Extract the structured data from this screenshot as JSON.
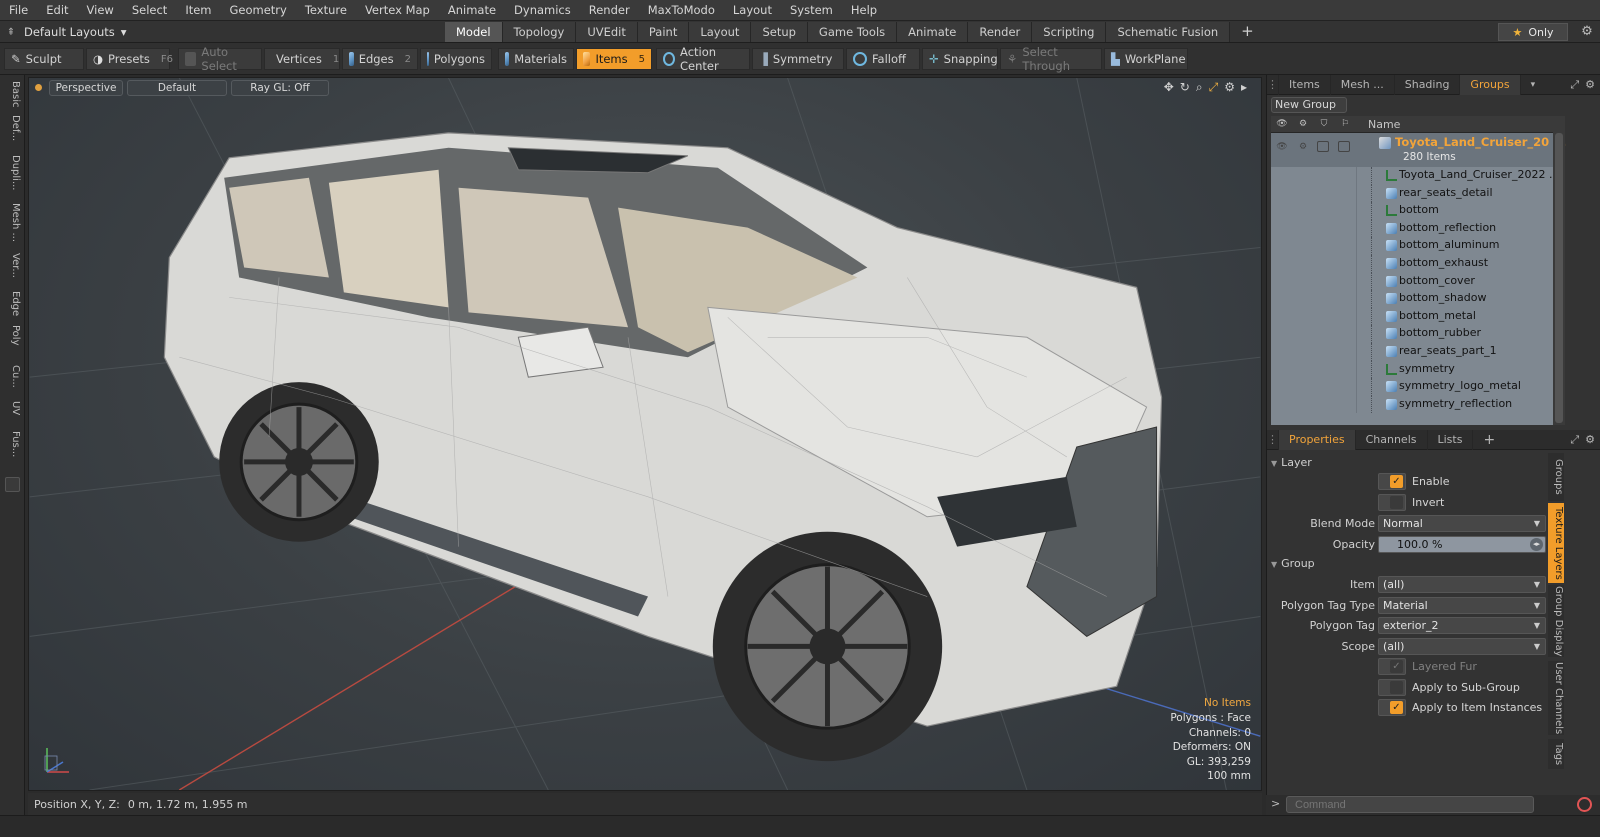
{
  "menu": [
    "File",
    "Edit",
    "View",
    "Select",
    "Item",
    "Geometry",
    "Texture",
    "Vertex Map",
    "Animate",
    "Dynamics",
    "Render",
    "MaxToModo",
    "Layout",
    "System",
    "Help"
  ],
  "layout": {
    "selector": "Default Layouts",
    "tabs": [
      "Model",
      "Topology",
      "UVEdit",
      "Paint",
      "Layout",
      "Setup",
      "Game Tools",
      "Animate",
      "Render",
      "Scripting",
      "Schematic Fusion"
    ],
    "active_tab": "Model",
    "only_label": "Only"
  },
  "toolbar": {
    "sculpt": "Sculpt",
    "presets": "Presets",
    "presets_key": "F6",
    "auto_select": "Auto Select",
    "vertices": "Vertices",
    "vertices_key": "1",
    "edges": "Edges",
    "edges_key": "2",
    "polygons": "Polygons",
    "materials": "Materials",
    "items": "Items",
    "items_key": "5",
    "action_center": "Action Center",
    "symmetry": "Symmetry",
    "falloff": "Falloff",
    "snapping": "Snapping",
    "select_through": "Select Through",
    "workplane": "WorkPlane"
  },
  "left_tabs": [
    "Basic",
    "Def...",
    "Dupli...",
    "Mesh ...",
    "Ver...",
    "Edge",
    "Poly",
    "Cu...",
    "UV",
    "Fus..."
  ],
  "viewport": {
    "view": "Perspective",
    "shading": "Default",
    "raygl": "Ray GL: Off",
    "stats": {
      "selection": "No Items",
      "polygons": "Polygons : Face",
      "channels": "Channels: 0",
      "deformers": "Deformers: ON",
      "gl": "GL: 393,259",
      "scale": "100 mm"
    }
  },
  "status": {
    "position_label": "Position X, Y, Z:",
    "position_value": "0 m, 1.72 m, 1.955 m"
  },
  "items_panel": {
    "tabs": [
      "Items",
      "Mesh ...",
      "Shading",
      "Groups"
    ],
    "active": "Groups",
    "new_group": "New Group",
    "name_col": "Name",
    "group_name": "Toyota_Land_Cruiser_20 ...",
    "group_count": "280 Items",
    "items": [
      {
        "name": "Toyota_Land_Cruiser_2022 ...",
        "type": "locator"
      },
      {
        "name": "rear_seats_detail",
        "type": "mesh"
      },
      {
        "name": "bottom",
        "type": "locator"
      },
      {
        "name": "bottom_reflection",
        "type": "mesh"
      },
      {
        "name": "bottom_aluminum",
        "type": "mesh"
      },
      {
        "name": "bottom_exhaust",
        "type": "mesh"
      },
      {
        "name": "bottom_cover",
        "type": "mesh"
      },
      {
        "name": "bottom_shadow",
        "type": "mesh"
      },
      {
        "name": "bottom_metal",
        "type": "mesh"
      },
      {
        "name": "bottom_rubber",
        "type": "mesh"
      },
      {
        "name": "rear_seats_part_1",
        "type": "mesh"
      },
      {
        "name": "symmetry",
        "type": "locator"
      },
      {
        "name": "symmetry_logo_metal",
        "type": "mesh"
      },
      {
        "name": "symmetry_reflection",
        "type": "mesh"
      }
    ]
  },
  "properties": {
    "tabs": [
      "Properties",
      "Channels",
      "Lists"
    ],
    "active": "Properties",
    "layer_section": "Layer",
    "enable": "Enable",
    "invert": "Invert",
    "blend_mode_label": "Blend Mode",
    "blend_mode": "Normal",
    "opacity_label": "Opacity",
    "opacity": "100.0 %",
    "group_section": "Group",
    "item_label": "Item",
    "item": "(all)",
    "ptag_type_label": "Polygon Tag Type",
    "ptag_type": "Material",
    "ptag_label": "Polygon Tag",
    "ptag": "exterior_2",
    "scope_label": "Scope",
    "scope": "(all)",
    "layered_fur": "Layered Fur",
    "apply_sub": "Apply to Sub-Group",
    "apply_inst": "Apply to Item Instances"
  },
  "right_vtabs": [
    "Groups",
    "Texture Layers",
    "Group Display",
    "User Channels",
    "Tags"
  ],
  "right_vtab_active": "Texture Layers",
  "command": {
    "prompt": ">",
    "placeholder": "Command"
  },
  "colors": {
    "accent": "#f29d2a",
    "list_bg": "#7f8891",
    "group_text": "#f2a43a"
  }
}
